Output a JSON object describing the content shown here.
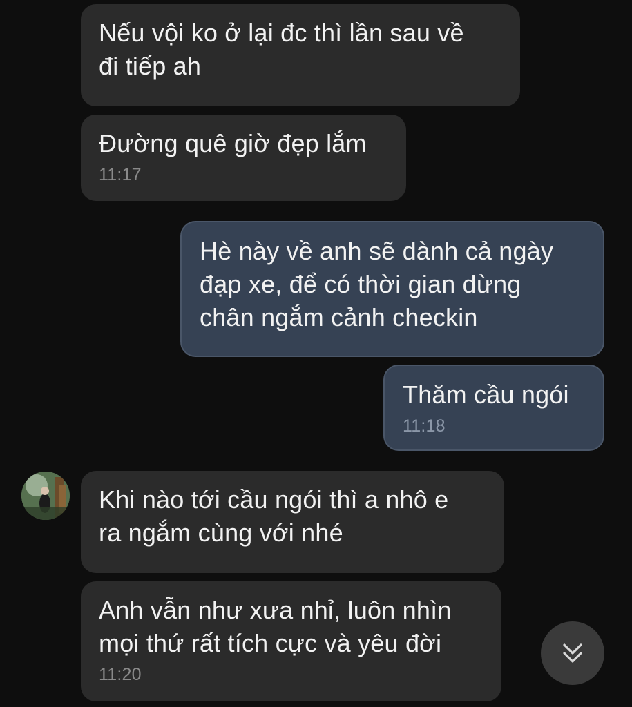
{
  "messages": [
    {
      "text": "Nếu vội ko ở lại đc thì lần sau về\nđi tiếp ah",
      "time": ""
    },
    {
      "text": "Đường quê giờ đẹp lắm",
      "time": "11:17"
    },
    {
      "text": "Hè này về anh sẽ dành cả ngày\nđạp xe, để có thời gian dừng\nchân ngắm cảnh checkin",
      "time": ""
    },
    {
      "text": "Thăm cầu ngói",
      "time": "11:18"
    },
    {
      "text": "Khi nào tới cầu ngói thì a nhô e\nra ngắm cùng với nhé",
      "time": ""
    },
    {
      "text": "Anh vẫn như xưa nhỉ, luôn nhìn\nmọi thứ rất tích cực và yêu đời",
      "time": "11:20"
    }
  ],
  "icons": {
    "avatar": "contact-avatar-photo",
    "scroll": "chevron-double-down-icon"
  },
  "colors": {
    "background": "#0e0e0e",
    "incoming_bubble": "#2b2b2b",
    "outgoing_bubble": "#364254",
    "text": "#f2f2f2",
    "timestamp": "#8a8a8a"
  }
}
